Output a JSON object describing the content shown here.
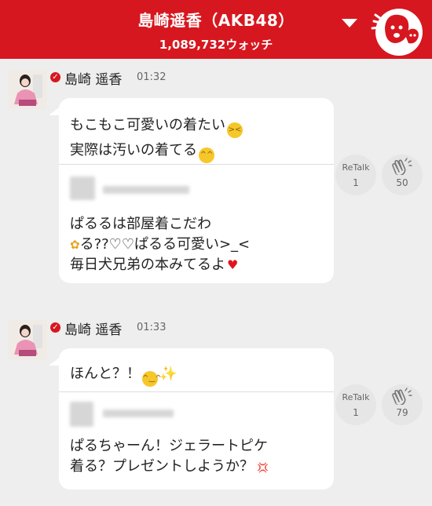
{
  "header": {
    "title": "島崎遥香（AKB48）",
    "watch_count": "1,089,732ウォッチ"
  },
  "posts": [
    {
      "author": "島崎 遥香",
      "time": "01:32",
      "lines": [
        "もこもこ可愛いの着たい",
        "実際は汚いの着てる"
      ],
      "quote": [
        "ぱるるは部屋着こだわ",
        "る??♡♡ぱるる可愛い>_<",
        "毎日犬兄弟の本みてるよ"
      ],
      "retalk_label": "ReTalk",
      "retalk_count": "1",
      "clap_count": "50"
    },
    {
      "author": "島崎 遥香",
      "time": "01:33",
      "lines": [
        "ほんと？！"
      ],
      "quote": [
        "ぱるちゃーん！ジェラートピケ",
        "着る？プレゼントしようか？"
      ],
      "retalk_label": "ReTalk",
      "retalk_count": "1",
      "clap_count": "79"
    }
  ],
  "icons": {
    "dropdown": "chevron-down-icon",
    "mascot": "mascot-icon",
    "verified": "check-icon",
    "clap": "clap-icon"
  },
  "colors": {
    "brand": "#d7171f",
    "background": "#eeeeee",
    "bubble": "#ffffff"
  }
}
